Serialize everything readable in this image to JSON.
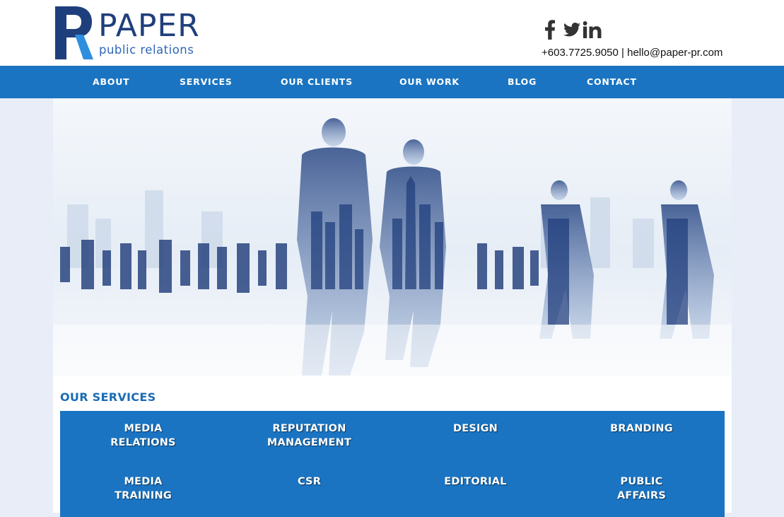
{
  "brand": {
    "name": "PAPER",
    "tagline": "public relations",
    "icon": "paper-pr-logo-mark"
  },
  "social": [
    {
      "name": "facebook-icon",
      "glyph": "f"
    },
    {
      "name": "twitter-icon",
      "glyph": "twitter"
    },
    {
      "name": "linkedin-icon",
      "glyph": "in"
    }
  ],
  "contact": {
    "phone": "+603.7725.9050",
    "separator": "|",
    "email": "hello@paper-pr.com"
  },
  "nav": {
    "items": [
      {
        "label": "ABOUT"
      },
      {
        "label": "SERVICES"
      },
      {
        "label": "OUR CLIENTS"
      },
      {
        "label": "OUR WORK"
      },
      {
        "label": "BLOG"
      },
      {
        "label": "CONTACT"
      }
    ]
  },
  "hero": {
    "image": "business-people-walking-city-double-exposure"
  },
  "services": {
    "title": "OUR SERVICES",
    "items": [
      {
        "line1": "MEDIA",
        "line2": "RELATIONS"
      },
      {
        "line1": "REPUTATION",
        "line2": "MANAGEMENT"
      },
      {
        "line1": "DESIGN",
        "line2": ""
      },
      {
        "line1": "BRANDING",
        "line2": ""
      },
      {
        "line1": "MEDIA",
        "line2": "TRAINING"
      },
      {
        "line1": "CSR",
        "line2": ""
      },
      {
        "line1": "EDITORIAL",
        "line2": ""
      },
      {
        "line1": "PUBLIC",
        "line2": "AFFAIRS"
      }
    ]
  },
  "colors": {
    "brand_dark": "#1f3f7c",
    "brand_blue": "#1a74c2",
    "page_bg": "#e8edf7"
  }
}
